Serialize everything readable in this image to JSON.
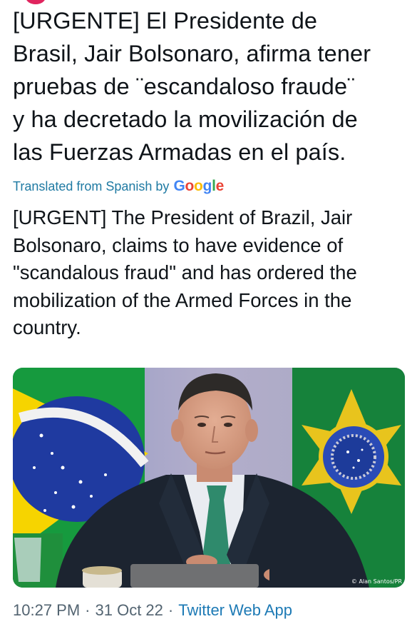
{
  "tweet": {
    "original_lines": [
      "[URGENTE] El Presidente de",
      "Brasil, Jair Bolsonaro, afirma tener",
      "pruebas de ¨escandaloso fraude¨",
      "y ha decretado la movilización de",
      "las Fuerzas Armadas en el país."
    ],
    "translated_from_label": "Translated from Spanish by",
    "translator": "Google",
    "translation_lines": [
      "[URGENT] The President of Brazil, Jair",
      "Bolsonaro, claims to have evidence of",
      "\"scandalous fraud\" and has ordered the",
      "mobilization of the Armed Forces in the",
      "country."
    ],
    "photo_credit": "© Alan Santos/PR",
    "time": "10:27 PM",
    "date": "31 Oct 22",
    "source": "Twitter Web App",
    "separator": "·"
  },
  "colors": {
    "text": "#0f1419",
    "muted": "#536471",
    "link": "#1d7ab5",
    "google_blue": "#4285f4",
    "google_red": "#ea4335",
    "google_yellow": "#fbbc05",
    "google_green": "#34a853"
  }
}
